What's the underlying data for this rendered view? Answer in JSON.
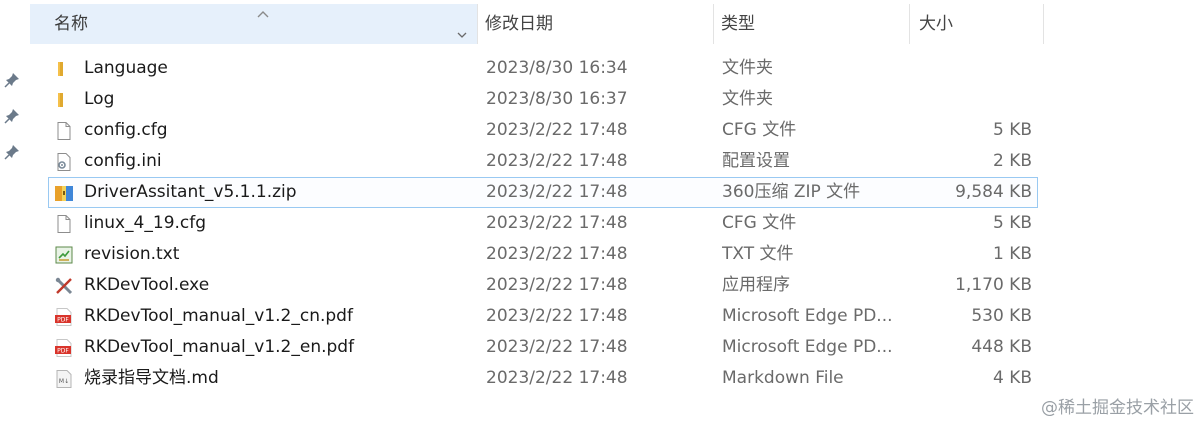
{
  "header": {
    "name_label": "名称",
    "date_label": "修改日期",
    "type_label": "类型",
    "size_label": "大小"
  },
  "files": [
    {
      "icon": "folder-icon",
      "name": "Language",
      "date": "2023/8/30 16:34",
      "type": "文件夹",
      "size": ""
    },
    {
      "icon": "folder-icon",
      "name": "Log",
      "date": "2023/8/30 16:37",
      "type": "文件夹",
      "size": ""
    },
    {
      "icon": "file-icon",
      "name": "config.cfg",
      "date": "2023/2/22 17:48",
      "type": "CFG 文件",
      "size": "5 KB"
    },
    {
      "icon": "config-file-icon",
      "name": "config.ini",
      "date": "2023/2/22 17:48",
      "type": "配置设置",
      "size": "2 KB"
    },
    {
      "icon": "zip-archive-icon",
      "name": "DriverAssitant_v5.1.1.zip",
      "date": "2023/2/22 17:48",
      "type": "360压缩 ZIP 文件",
      "size": "9,584 KB"
    },
    {
      "icon": "file-icon",
      "name": "linux_4_19.cfg",
      "date": "2023/2/22 17:48",
      "type": "CFG 文件",
      "size": "5 KB"
    },
    {
      "icon": "text-file-icon",
      "name": "revision.txt",
      "date": "2023/2/22 17:48",
      "type": "TXT 文件",
      "size": "1 KB"
    },
    {
      "icon": "tools-exe-icon",
      "name": "RKDevTool.exe",
      "date": "2023/2/22 17:48",
      "type": "应用程序",
      "size": "1,170 KB"
    },
    {
      "icon": "pdf-icon",
      "name": "RKDevTool_manual_v1.2_cn.pdf",
      "date": "2023/2/22 17:48",
      "type": "Microsoft Edge PD...",
      "size": "530 KB"
    },
    {
      "icon": "pdf-icon",
      "name": "RKDevTool_manual_v1.2_en.pdf",
      "date": "2023/2/22 17:48",
      "type": "Microsoft Edge PD...",
      "size": "448 KB"
    },
    {
      "icon": "markdown-file-icon",
      "name": "烧录指导文档.md",
      "date": "2023/2/22 17:48",
      "type": "Markdown File",
      "size": "4 KB"
    }
  ],
  "selected_index": 4,
  "watermark": "@稀土掘金技术社区",
  "colors": {
    "header_highlight": "#e6f0fb",
    "selection_border": "#99c9f2",
    "folder": "#f5c04a",
    "pdf": "#d9342b"
  }
}
